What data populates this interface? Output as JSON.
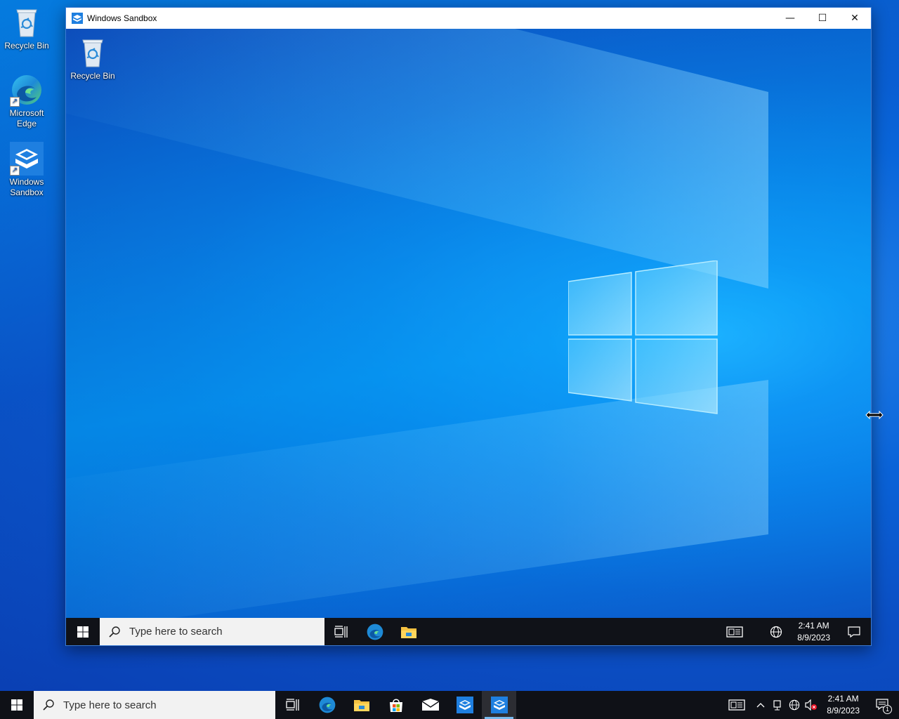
{
  "host_desktop": {
    "icons": [
      {
        "label": "Recycle Bin",
        "icon": "recycle-bin-icon"
      },
      {
        "label": "Microsoft Edge",
        "icon": "edge-icon"
      },
      {
        "label": "Windows Sandbox",
        "icon": "sandbox-icon"
      }
    ]
  },
  "sandbox_window": {
    "title": "Windows Sandbox",
    "controls": {
      "minimize": "—",
      "maximize": "☐",
      "close": "✕"
    },
    "desktop_icons": [
      {
        "label": "Recycle Bin",
        "icon": "recycle-bin-icon"
      }
    ],
    "taskbar": {
      "search_placeholder": "Type here to search",
      "pinned": [
        "task-view-icon",
        "edge-icon",
        "file-explorer-icon"
      ],
      "tray": [
        "news-icon",
        "network-icon"
      ],
      "time": "2:41 AM",
      "date": "8/9/2023"
    }
  },
  "host_taskbar": {
    "search_placeholder": "Type here to search",
    "pinned": [
      "task-view-icon",
      "edge-icon",
      "file-explorer-icon",
      "store-icon",
      "mail-icon",
      "sandbox-icon",
      "sandbox-icon-active"
    ],
    "tray": [
      "news-icon",
      "chevron-up-icon",
      "meet-icon",
      "network-icon",
      "volume-muted-icon"
    ],
    "time": "2:41 AM",
    "date": "8/9/2023",
    "notification_count": "1"
  },
  "colors": {
    "accent": "#0078d7",
    "taskbar": "#0f1117",
    "active_indicator": "#76b9ed"
  }
}
